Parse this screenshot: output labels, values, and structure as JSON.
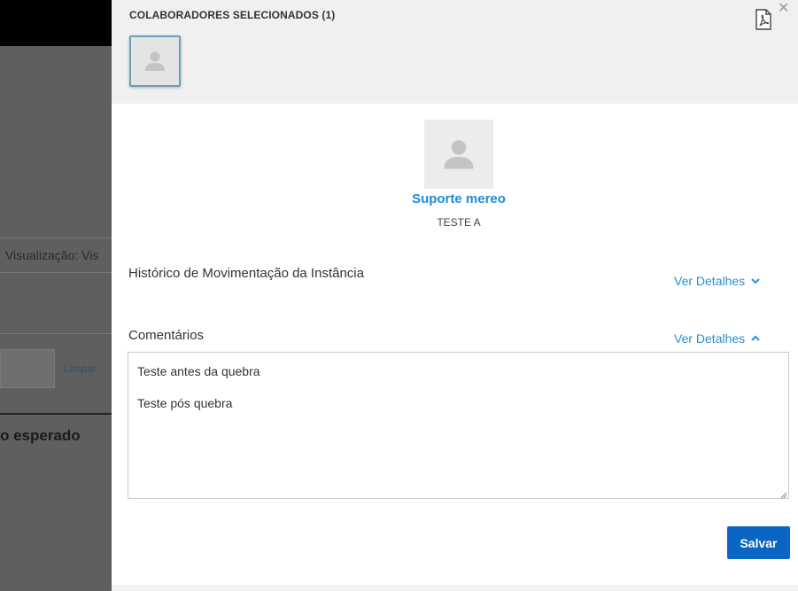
{
  "background": {
    "visualizacao_text": "Visualização: Vis",
    "limpar_link": "Limpar",
    "esperado_text": "o esperado"
  },
  "drawer": {
    "header": {
      "title": "COLABORADORES SELECIONADOS (1)",
      "pdf_icon": "pdf-icon",
      "close_icon": "close-icon"
    },
    "profile": {
      "name": "Suporte mereo",
      "subtitle": "TESTE A"
    },
    "historico": {
      "title": "Histórico de Movimentação da Instância",
      "link": "Ver Detalhes",
      "expanded": false
    },
    "comentarios": {
      "title": "Comentários",
      "link": "Ver Detalhes",
      "expanded": true,
      "lines": [
        "Teste antes da quebra",
        "Teste pós quebra"
      ]
    },
    "save_label": "Salvar"
  },
  "colors": {
    "accent": "#1f8bd9",
    "button": "#0a66c2",
    "header_bg": "#f0f0f0"
  }
}
